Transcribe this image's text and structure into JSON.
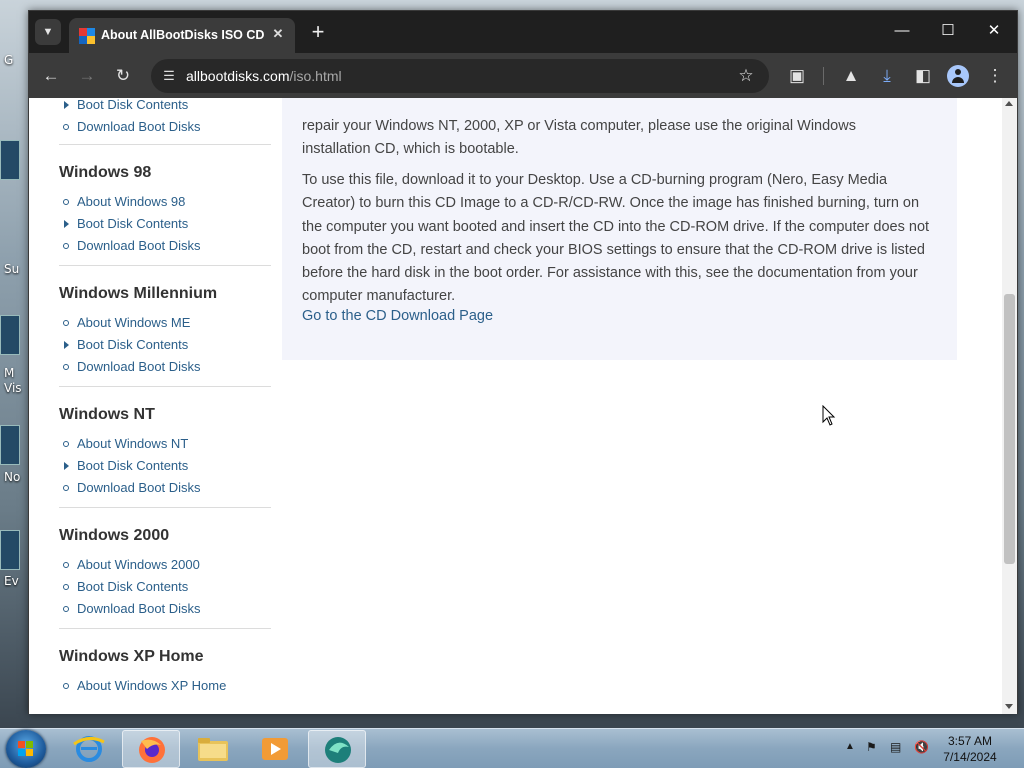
{
  "browser": {
    "tab_title": "About AllBootDisks ISO CD Im",
    "url_host": "allbootdisks.com",
    "url_path": "/iso.html"
  },
  "sidebar": {
    "top_links": [
      "Boot Disk Contents",
      "Download Boot Disks"
    ],
    "sections": [
      {
        "title": "Windows 98",
        "links": [
          "About Windows 98",
          "Boot Disk Contents",
          "Download Boot Disks"
        ]
      },
      {
        "title": "Windows Millennium",
        "links": [
          "About Windows ME",
          "Boot Disk Contents",
          "Download Boot Disks"
        ]
      },
      {
        "title": "Windows NT",
        "links": [
          "About Windows NT",
          "Boot Disk Contents",
          "Download Boot Disks"
        ]
      },
      {
        "title": "Windows 2000",
        "links": [
          "About Windows 2000",
          "Boot Disk Contents",
          "Download Boot Disks"
        ]
      },
      {
        "title": "Windows XP Home",
        "links": [
          "About Windows XP Home"
        ]
      }
    ]
  },
  "content": {
    "para1_line1": "repair your Windows NT, 2000, XP or Vista computer, please use the original Windows",
    "para1_line2": "installation CD, which is bootable.",
    "para2": "To use this file, download it to your Desktop. Use a CD-burning program (Nero, Easy Media Creator) to burn this CD Image to a CD-R/CD-RW. Once the image has finished burning, turn on the computer you want booted and insert the CD into the CD-ROM drive. If the computer does not boot from the CD, restart and check your BIOS settings to ensure that the CD-ROM drive is listed before the hard disk in the boot order. For assistance with this, see the documentation from your computer manufacturer.",
    "cd_link": "Go to the CD Download Page"
  },
  "taskbar": {
    "time": "3:57 AM",
    "date": "7/14/2024"
  },
  "desktop_labels": [
    "G",
    "Su",
    "M",
    "Vis",
    "No",
    "Ev"
  ]
}
